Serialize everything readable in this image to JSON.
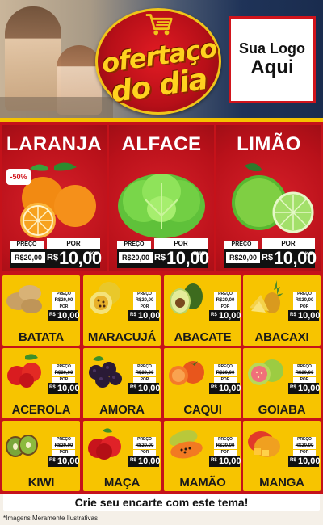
{
  "header": {
    "brand_line1": "ofertaço",
    "brand_line2": "do dia",
    "logo_line1": "Sua Logo",
    "logo_line2": "Aqui"
  },
  "featured": [
    {
      "name": "LARANJA",
      "discount": "-50%",
      "preco_label": "PREÇO",
      "por_label": "POR",
      "old_price": "R$20,00",
      "currency": "R$",
      "price": "10,00",
      "unit": "KG",
      "icon": "orange-icon"
    },
    {
      "name": "ALFACE",
      "discount": "",
      "preco_label": "PREÇO",
      "por_label": "POR",
      "old_price": "R$20,00",
      "currency": "R$",
      "price": "10,00",
      "unit": "UNID",
      "icon": "lettuce-icon"
    },
    {
      "name": "LIMÃO",
      "discount": "",
      "preco_label": "PREÇO",
      "por_label": "POR",
      "old_price": "R$20,00",
      "currency": "R$",
      "price": "10,00",
      "unit": "KG",
      "icon": "lime-icon"
    }
  ],
  "grid": [
    {
      "name": "BATATA",
      "preco_label": "PREÇO",
      "old_price": "R$20,00",
      "por_label": "POR",
      "currency": "R$",
      "price": "10,00",
      "icon": "potato-icon"
    },
    {
      "name": "MARACUJÁ",
      "preco_label": "PREÇO",
      "old_price": "R$20,00",
      "por_label": "POR",
      "currency": "R$",
      "price": "10,00",
      "icon": "passionfruit-icon"
    },
    {
      "name": "ABACATE",
      "preco_label": "PREÇO",
      "old_price": "R$20,00",
      "por_label": "POR",
      "currency": "R$",
      "price": "10,00",
      "icon": "avocado-icon"
    },
    {
      "name": "ABACAXI",
      "preco_label": "PREÇO",
      "old_price": "R$20,00",
      "por_label": "POR",
      "currency": "R$",
      "price": "10,00",
      "icon": "pineapple-icon"
    },
    {
      "name": "ACEROLA",
      "preco_label": "PREÇO",
      "old_price": "R$20,00",
      "por_label": "POR",
      "currency": "R$",
      "price": "10,00",
      "icon": "acerola-icon"
    },
    {
      "name": "AMORA",
      "preco_label": "PREÇO",
      "old_price": "R$20,00",
      "por_label": "POR",
      "currency": "R$",
      "price": "10,00",
      "icon": "blackberry-icon"
    },
    {
      "name": "CAQUI",
      "preco_label": "PREÇO",
      "old_price": "R$20,00",
      "por_label": "POR",
      "currency": "R$",
      "price": "10,00",
      "icon": "persimmon-icon"
    },
    {
      "name": "GOIABA",
      "preco_label": "PREÇO",
      "old_price": "R$20,00",
      "por_label": "POR",
      "currency": "R$",
      "price": "10,00",
      "icon": "guava-icon"
    },
    {
      "name": "KIWI",
      "preco_label": "PREÇO",
      "old_price": "R$20,00",
      "por_label": "POR",
      "currency": "R$",
      "price": "10,00",
      "icon": "kiwi-icon"
    },
    {
      "name": "MAÇA",
      "preco_label": "PREÇO",
      "old_price": "R$20,00",
      "por_label": "POR",
      "currency": "R$",
      "price": "10,00",
      "icon": "apple-icon"
    },
    {
      "name": "MAMÃO",
      "preco_label": "PREÇO",
      "old_price": "R$20,00",
      "por_label": "POR",
      "currency": "R$",
      "price": "10,00",
      "icon": "papaya-icon"
    },
    {
      "name": "MANGA",
      "preco_label": "PREÇO",
      "old_price": "R$20,00",
      "por_label": "POR",
      "currency": "R$",
      "price": "10,00",
      "icon": "mango-icon"
    }
  ],
  "cta": "Crie seu encarte com este tema!",
  "footnote": "*Imagens Meramente Ilustrativas",
  "colors": {
    "red": "#c5121a",
    "yellow": "#f7c400",
    "navy": "#1a2c4e"
  }
}
